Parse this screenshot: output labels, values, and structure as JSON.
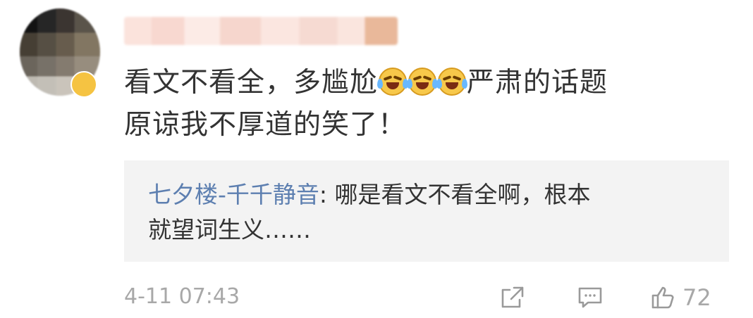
{
  "comment": {
    "text_before": "看文不看全，多尴尬",
    "emoji_count": 3,
    "emoji_name": "laugh-cry-emoji",
    "text_after_line1": "严肃的话题",
    "text_line2": "原谅我不厚道的笑了！"
  },
  "reply": {
    "username": "七夕楼-千千静音",
    "separator": ": ",
    "text_line1": "哪是看文不看全啊，根本",
    "text_line2": "就望词生义……"
  },
  "meta": {
    "timestamp": "4-11 07:43",
    "like_count": "72"
  },
  "icons": {
    "share": "share-icon",
    "comment": "comment-icon",
    "like": "thumbs-up-icon"
  },
  "colors": {
    "username_link": "#5d7fb0",
    "meta_gray": "#a8a8a8",
    "reply_bg": "#f3f3f3"
  }
}
